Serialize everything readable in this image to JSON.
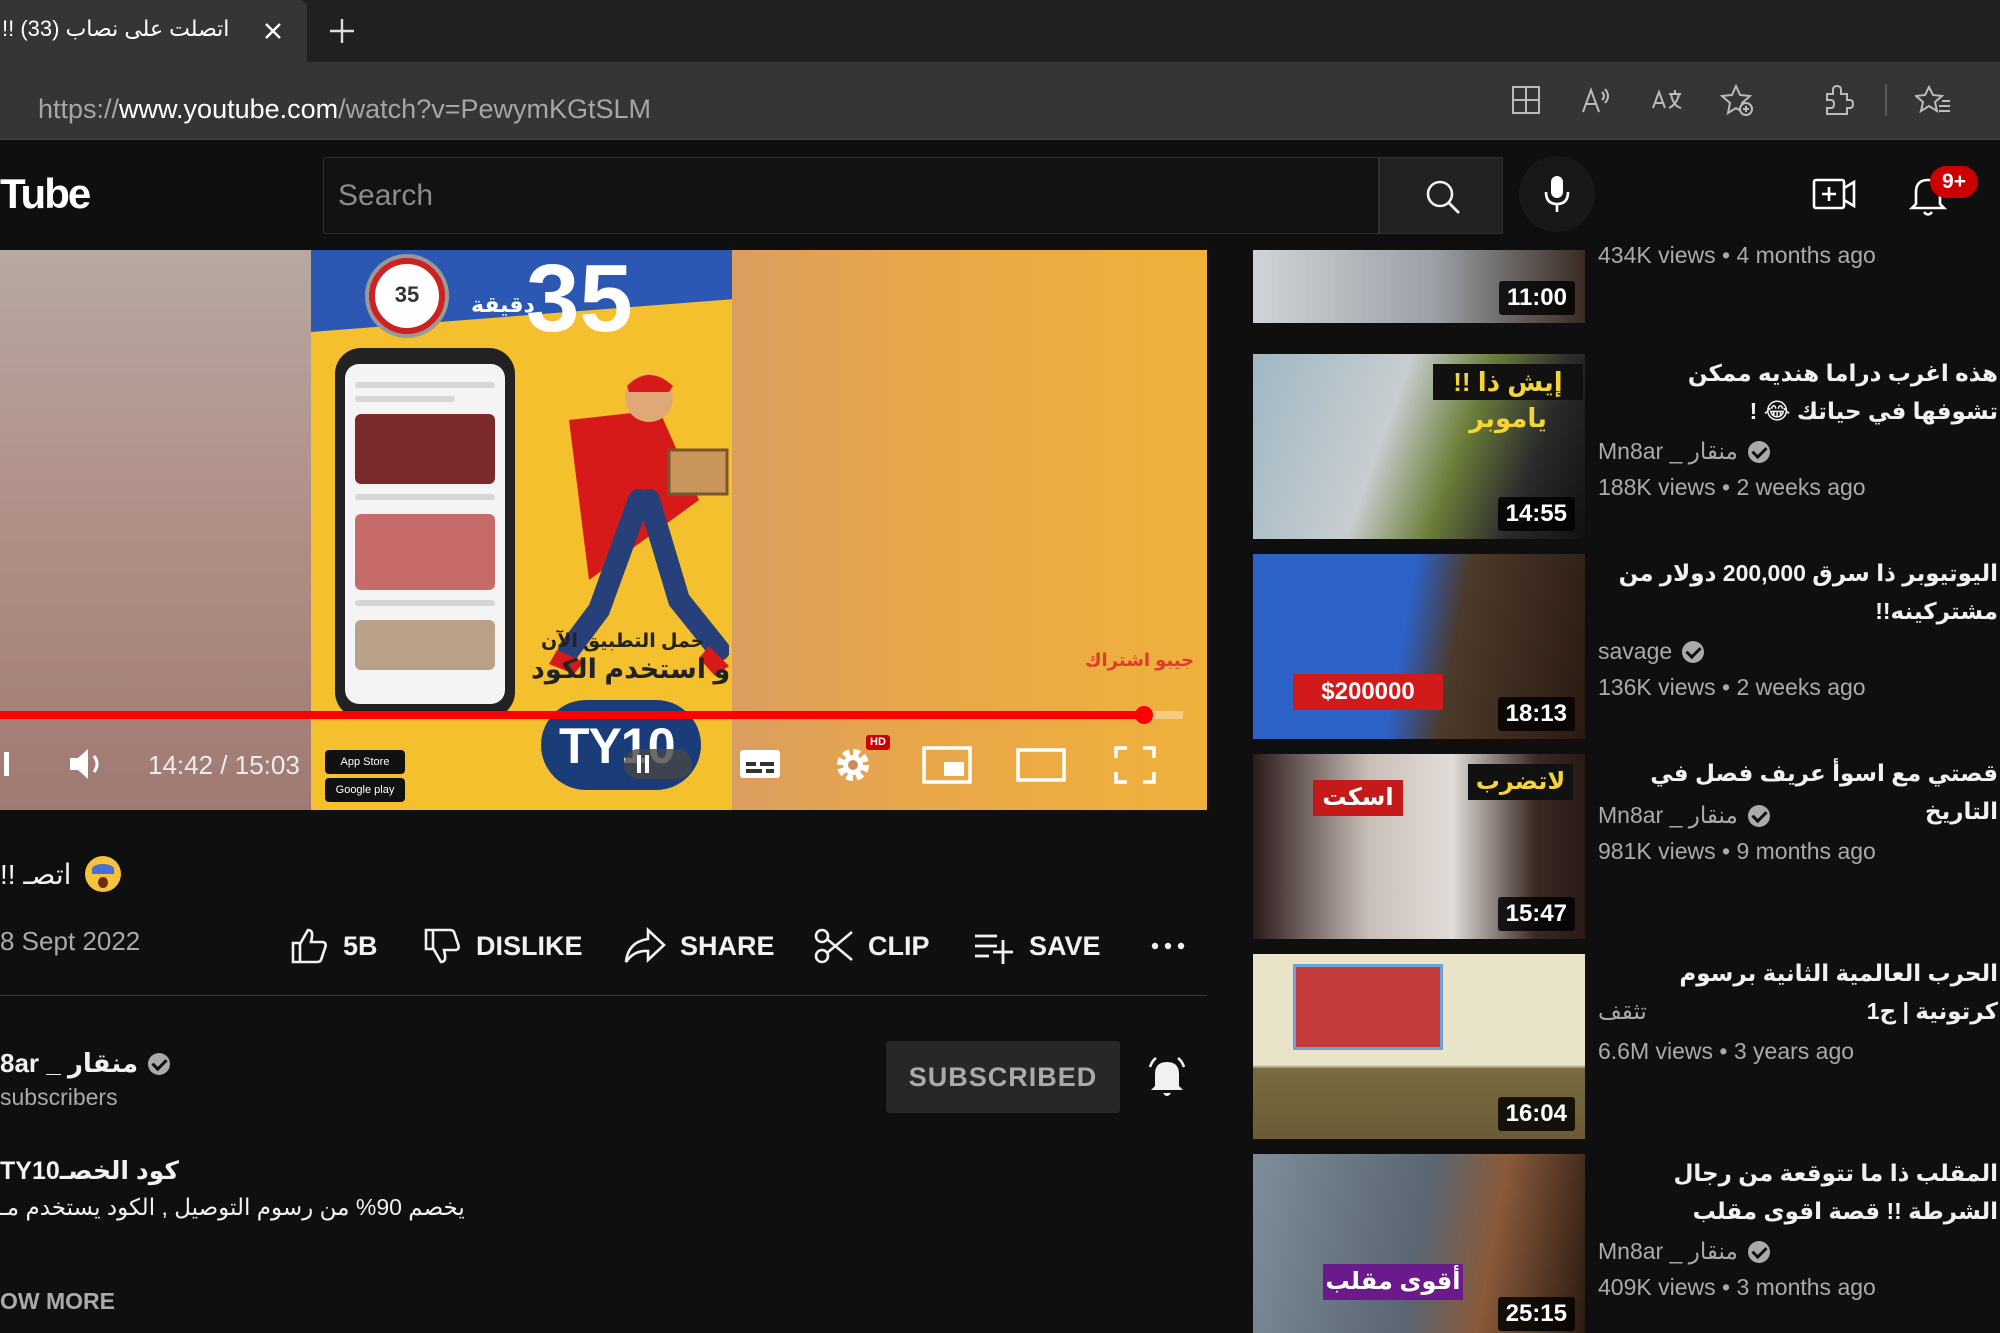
{
  "browser": {
    "tab_title": "!! اتصلت على نصاب (33)",
    "url_scheme": "https://",
    "url_host": "www.youtube.com",
    "url_path": "/watch?v=PewymKGtSLM",
    "toolbar_icons": [
      "split-screen-icon",
      "read-aloud-icon",
      "translate-icon",
      "add-favorite-icon",
      "extensions-icon",
      "favorites-icon"
    ]
  },
  "masthead": {
    "logo_text": "Tube",
    "search_placeholder": "Search",
    "notification_count": "9+"
  },
  "player": {
    "current_time": "14:42",
    "duration": "15:03",
    "time_display": "14:42 / 15:03",
    "progress_fraction": 0.967,
    "hd_label": "HD",
    "ad": {
      "headline_number": "35",
      "minutes_label": "دقيقة",
      "timer_number": "35",
      "line1": "حمل التطبيق الآن",
      "line2": "و استخدم الكود",
      "code": "TY10",
      "store1": "App Store",
      "store2": "Google play",
      "overlay_label": "جيبو اشتراك"
    }
  },
  "video": {
    "title": "!! اتصـ",
    "date": "8 Sept 2022",
    "likes": "5B",
    "dislike_label": "DISLIKE",
    "share_label": "SHARE",
    "clip_label": "CLIP",
    "save_label": "SAVE"
  },
  "channel": {
    "name": "8ar _ منقار",
    "subscribers": "subscribers",
    "subscribed_label": "SUBSCRIBED"
  },
  "description": {
    "line1": "TY10كود الخصـ",
    "line2": "يخصم 90% من رسوم التوصيل , الكود يستخدم مـ",
    "show_more": "OW MORE"
  },
  "recommendations": [
    {
      "title": "",
      "channel": "",
      "verified": false,
      "meta": "434K views • 4 months ago",
      "duration": "11:00",
      "colors": [
        "#c9c9c9",
        "#3b3b3b"
      ]
    },
    {
      "title": "هذه اغرب دراما هنديه ممكن تشوفها في حياتك 😂 !",
      "channel": "Mn8ar _ منقار",
      "verified": true,
      "meta": "188K views • 2 weeks ago",
      "duration": "14:55",
      "colors": [
        "#b8c6c9",
        "#4a4a4a"
      ]
    },
    {
      "title": "اليوتيوبر ذا سرق 200,000 دولار من مشتركينه!!",
      "channel": "savage",
      "verified": true,
      "meta": "136K views • 2 weeks ago",
      "duration": "18:13",
      "colors": [
        "#2f60c4",
        "#7a2d10"
      ]
    },
    {
      "title": "قصتي مع اسوأ عريف فصل في التاريخ",
      "channel": "Mn8ar _ منقار",
      "verified": true,
      "meta": "981K views • 9 months ago",
      "duration": "15:47",
      "colors": [
        "#d8d0cc",
        "#3a2a2a"
      ]
    },
    {
      "title": "الحرب العالمية الثانية برسوم كرتونية | ج1",
      "channel": "تثقف",
      "verified": false,
      "meta": "6.6M views • 3 years ago",
      "duration": "16:04",
      "colors": [
        "#e6e0c8",
        "#b89b5e"
      ]
    },
    {
      "title": "المقلب ذا ما تتوقعة من رجال الشرطة !! قصة اقوى مقلب",
      "channel": "Mn8ar _ منقار",
      "verified": true,
      "meta": "409K views • 3 months ago",
      "duration": "25:15",
      "colors": [
        "#7b8a96",
        "#2a2a2a"
      ]
    }
  ]
}
